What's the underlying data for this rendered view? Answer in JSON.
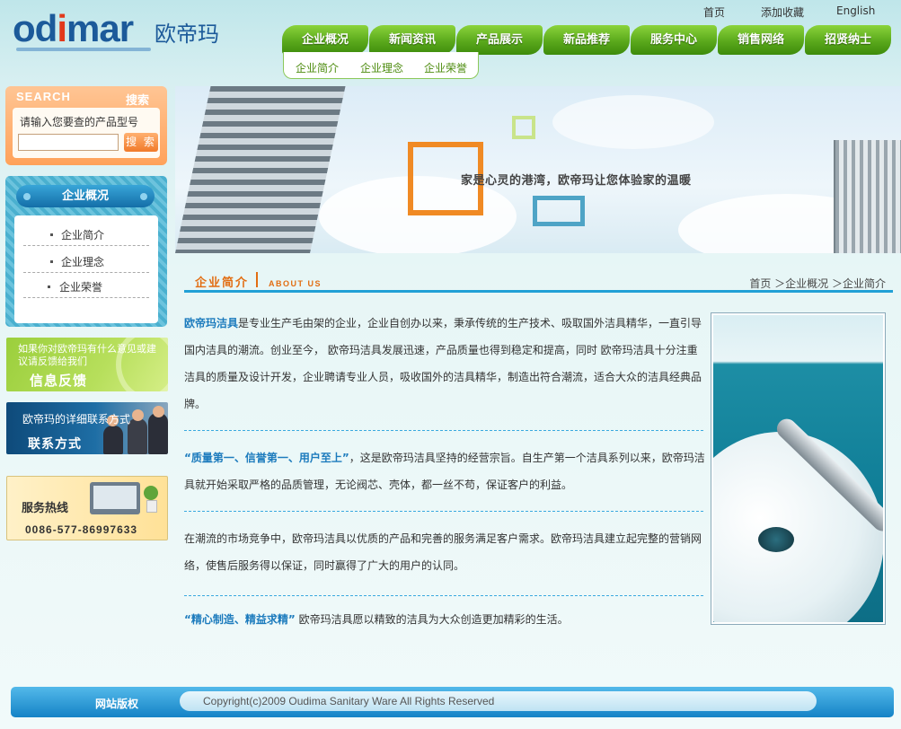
{
  "brand": {
    "wordmark_pre": "od",
    "wordmark_i": "i",
    "wordmark_post": "mar",
    "name_cn": "欧帝玛",
    "primary_color": "#1c5a9a",
    "accent_color": "#e2381a"
  },
  "top_links": [
    "首页",
    "添加收藏",
    "English"
  ],
  "main_nav": [
    "企业概况",
    "新闻资讯",
    "产品展示",
    "新品推荐",
    "服务中心",
    "销售网络",
    "招贤纳士"
  ],
  "sub_nav": [
    "企业简介",
    "企业理念",
    "企业荣誉"
  ],
  "search": {
    "title_en": "SEARCH",
    "title_cn": "搜索",
    "hint": "请输入您要查的产品型号",
    "value": "",
    "button": "搜 索"
  },
  "side_menu": {
    "title": "企业概况",
    "items": [
      "企业简介",
      "企业理念",
      "企业荣誉"
    ]
  },
  "promos": {
    "feedback_small": "如果你对欧帝玛有什么意见或建议请反馈给我们",
    "feedback_big": "信息反馈",
    "contact_small": "欧帝玛的详细联系方式",
    "contact_big": "联系方式",
    "hotline_big": "服务热线",
    "hotline_phone": "0086-577-86997633"
  },
  "banner": {
    "slogan": "家是心灵的港湾，欧帝玛让您体验家的温暖",
    "square_colors": [
      "#f08a24",
      "#c9e48a",
      "#4ea4c6"
    ]
  },
  "section": {
    "title_cn": "企业简介",
    "title_en": "ABOUT US",
    "breadcrumb": "首页 ＞企业概况 ＞企业简介"
  },
  "article": {
    "p1_lead": "欧帝玛洁具",
    "p1_rest": "是专业生产毛由架的企业，企业自创办以来，秉承传统的生产技术、吸取国外洁具精华，一直引导国内洁具的潮流。创业至今， 欧帝玛洁具发展迅速，产品质量也得到稳定和提高，同时 欧帝玛洁具十分注重洁具的质量及设计开发，企业聘请专业人员，吸收国外的洁具精华，制造出符合潮流，适合大众的洁具经典品牌。",
    "p2_lead": "“质量第一、信誉第一、用户至上”",
    "p2_rest": "，这是欧帝玛洁具坚持的经营宗旨。自生产第一个洁具系列以来，欧帝玛洁具就开始采取严格的品质管理，无论阀芯、壳体，都一丝不苟，保证客户的利益。",
    "p3": "在潮流的市场竞争中，欧帝玛洁具以优质的产品和完善的服务满足客户需求。欧帝玛洁具建立起完整的营销网络，使售后服务得以保证，同时赢得了广大的用户的认同。",
    "p4_lead": "“精心制造、精益求精”",
    "p4_rest": " 欧帝玛洁具愿以精致的洁具为大众创造更加精彩的生活。"
  },
  "footer": {
    "tag": "网站版权",
    "copyright": "Copyright(c)2009 Oudima Sanitary Ware All Rights Reserved"
  }
}
